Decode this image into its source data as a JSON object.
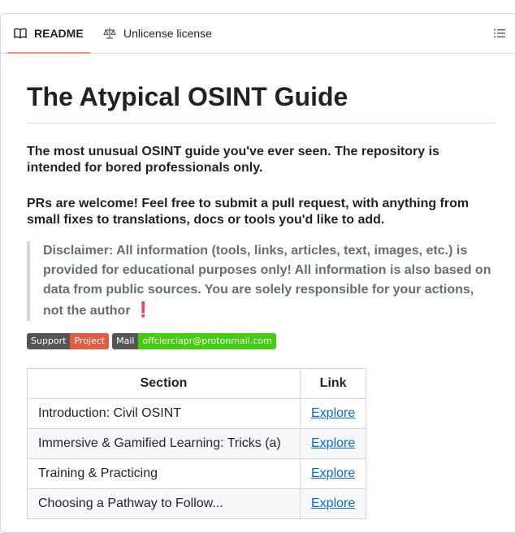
{
  "tabs": {
    "readme": "README",
    "license": "Unlicense license"
  },
  "readme": {
    "title": "The Atypical OSINT Guide",
    "intro": "The most unusual OSINT guide you've ever seen. The repository is intended for bored professionals only.",
    "prs": "PRs are welcome! Feel free to submit a pull request, with anything from small fixes to translations, docs or tools you'd like to add.",
    "disclaimer": "Disclaimer: All information (tools, links, articles, text, images, etc.) is provided for educational purposes only! All information is also based on data from public sources. You are solely responsible for your actions, not the author",
    "disclaimer_mark": "❗",
    "badges": [
      {
        "left": "Support",
        "right": "Project",
        "color": "#e05d44"
      },
      {
        "left": "Mail",
        "right": "offcierciapr@protonmail.com",
        "color": "#4c1"
      }
    ],
    "table": {
      "headers": [
        "Section",
        "Link"
      ],
      "rows": [
        {
          "section": "Introduction: Civil OSINT",
          "link": "Explore"
        },
        {
          "section": "Immersive & Gamified Learning: Tricks (a)",
          "link": "Explore"
        },
        {
          "section": "Training & Practicing",
          "link": "Explore"
        },
        {
          "section": "Choosing a Pathway to Follow...",
          "link": "Explore"
        }
      ]
    }
  }
}
